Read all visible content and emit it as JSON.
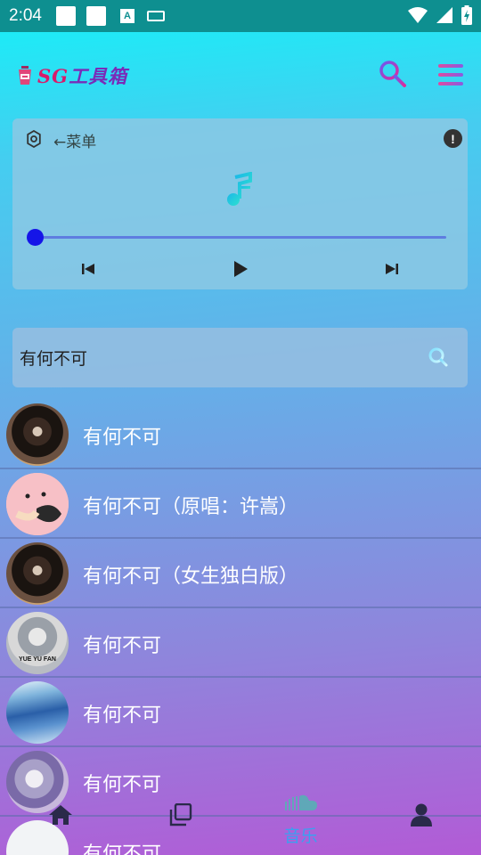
{
  "status_bar": {
    "time": "2:04",
    "a_glyph": "A",
    "icons": [
      "notification-square-icon",
      "notification-square-icon",
      "a-icon",
      "keyboard-icon",
      "wifi-icon",
      "signal-icon",
      "battery-charging-icon"
    ]
  },
  "app": {
    "logo_cup_icon": "cup-icon",
    "title_part1": "SG",
    "title_part2": "工具箱",
    "search_icon": "search-icon",
    "menu_icon": "hamburger-menu-icon",
    "accent_pink": "#d81b6b",
    "accent_purple": "#7a2bb8"
  },
  "player": {
    "menu_label": "←菜单",
    "info_glyph": "!",
    "progress": 0,
    "controls": [
      "previous-icon",
      "play-icon",
      "next-icon"
    ]
  },
  "search": {
    "value": "有何不可",
    "icon": "search-icon"
  },
  "songs": [
    {
      "title": "有何不可"
    },
    {
      "title": "有何不可（原唱：许嵩）"
    },
    {
      "title": "有何不可（女生独白版）"
    },
    {
      "title": "有何不可"
    },
    {
      "title": "有何不可"
    },
    {
      "title": "有何不可"
    },
    {
      "title": "有何不可"
    }
  ],
  "avatar_caption": "YUE YU FAN",
  "nav": {
    "items": [
      {
        "icon": "home-icon",
        "label": ""
      },
      {
        "icon": "copy-icon",
        "label": ""
      },
      {
        "icon": "soundcloud-icon",
        "label": "音乐"
      },
      {
        "icon": "user-icon",
        "label": ""
      }
    ],
    "active_color": "#3aa0f0"
  }
}
